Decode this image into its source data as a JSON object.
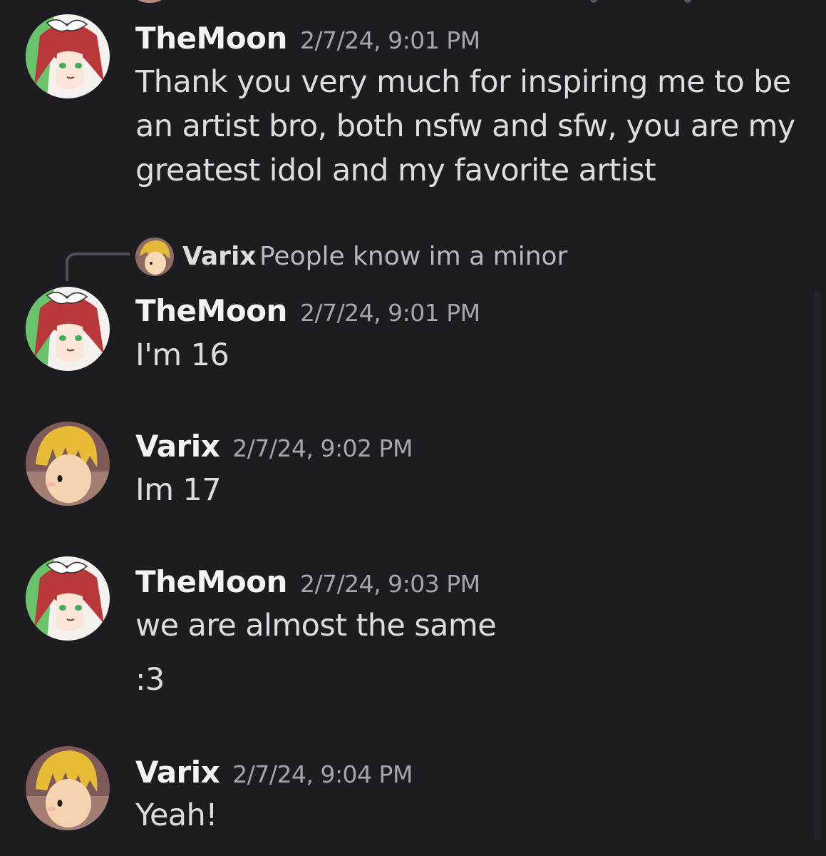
{
  "messages": [
    {
      "username": "TheMoon",
      "timestamp": "2/7/24, 9:01 PM",
      "content": "Thank you very much for inspiring me to be an artist bro, both nsfw and sfw, you are my greatest idol and my favorite artist",
      "avatar": "themoon-avatar"
    },
    {
      "username": "TheMoon",
      "timestamp": "2/7/24, 9:01 PM",
      "reply_to": {
        "username": "Varix",
        "content": "People know im a minor"
      },
      "content": "I'm 16",
      "avatar": "themoon-avatar"
    },
    {
      "username": "Varix",
      "timestamp": "2/7/24, 9:02 PM",
      "content": "Im 17",
      "avatar": "varix-avatar"
    },
    {
      "username": "TheMoon",
      "timestamp": "2/7/24, 9:03 PM",
      "content": "we are almost the same",
      "content_2": ":3",
      "avatar": "themoon-avatar"
    },
    {
      "username": "Varix",
      "timestamp": "2/7/24, 9:04 PM",
      "content": "Yeah!",
      "avatar": "varix-avatar"
    }
  ],
  "colors": {
    "background": "#1c1c21",
    "username": "#f2f3f5",
    "timestamp": "#a3a6ad",
    "text": "#dbdee1",
    "reply_text": "#b5bac1"
  }
}
